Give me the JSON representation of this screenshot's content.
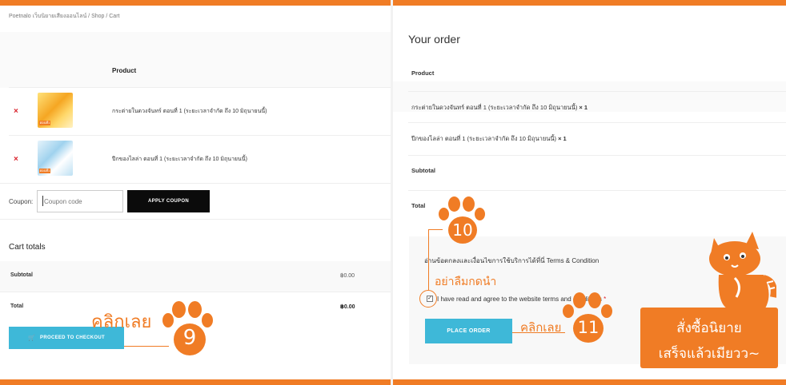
{
  "breadcrumb": "Poetnalo เว็บนิยายเสียงออนไลน์ / Shop / Cart",
  "cart": {
    "column_product": "Product",
    "items": [
      {
        "remove": "×",
        "thumb_tag": "ตอนที่1",
        "name": "กระต่ายในดวงจันทร์ ตอนที่ 1 (ระยะเวลาจำกัด ถึง 10 มิถุนายนนี้)"
      },
      {
        "remove": "×",
        "thumb_tag": "ตอนที่1",
        "name": "ปีกของไลล่า ตอนที่ 1 (ระยะเวลาจำกัด ถึง 10 มิถุนายนนี้)"
      }
    ],
    "coupon_label": "Coupon:",
    "coupon_placeholder": "Coupon code",
    "apply_coupon": "APPLY COUPON"
  },
  "cart_totals": {
    "title": "Cart totals",
    "subtotal_label": "Subtotal",
    "subtotal_value": "฿0.00",
    "total_label": "Total",
    "total_value": "฿0.00",
    "checkout_button": "PROCEED TO CHECKOUT"
  },
  "order": {
    "title": "Your order",
    "column_product": "Product",
    "items": [
      {
        "name": "กระต่ายในดวงจันทร์ ตอนที่ 1 (ระยะเวลาจำกัด ถึง 10 มิถุนายนนี้)",
        "qty": "× 1"
      },
      {
        "name": "ปีกของไลล่า ตอนที่ 1 (ระยะเวลาจำกัด ถึง 10 มิถุนายนนี้)",
        "qty": "× 1"
      }
    ],
    "subtotal_label": "Subtotal",
    "total_label": "Total",
    "terms_text": "อ่านข้อตกลงและเงื่อนไขการใช้บริการได้ที่นี่ Terms & Condition",
    "agree_text": "I have read and agree to the website terms and conditions",
    "required_mark": "*",
    "place_order": "PLACE ORDER"
  },
  "annotations": {
    "click_now_left": "คลิกเลย",
    "step_9": "9",
    "step_10": "10",
    "dont_forget": "อย่าลืมกดนำ",
    "click_now_right": "คลิกเลย",
    "step_11": "11",
    "cta_line1": "สั่งซื้อนิยาย",
    "cta_line2": "เสร็จแล้วเมียวว~"
  },
  "colors": {
    "brand_orange": "#f07c25",
    "button_blue": "#3eb8d8",
    "remove_red": "#d9232d"
  }
}
